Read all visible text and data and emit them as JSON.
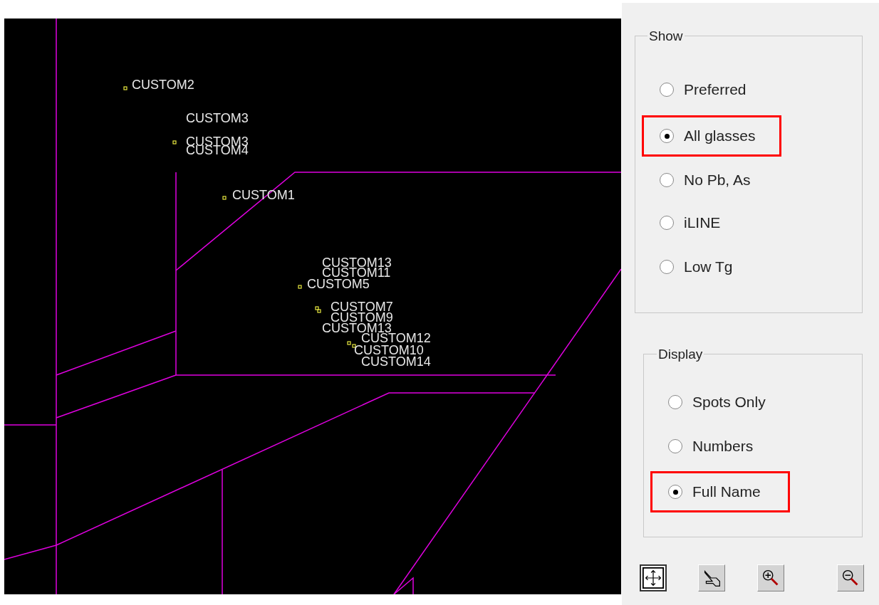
{
  "plot": {
    "points": [
      {
        "label": "CUSTOM2",
        "marker": true
      },
      {
        "label": "CUSTOM3",
        "marker": false
      },
      {
        "label": "CUSTOM3",
        "marker": true
      },
      {
        "label": "CUSTOM4",
        "marker": false
      },
      {
        "label": "CUSTOM1",
        "marker": true
      },
      {
        "label": "CUSTOM13",
        "marker": false
      },
      {
        "label": "CUSTOM11",
        "marker": false
      },
      {
        "label": "CUSTOM5",
        "marker": true
      },
      {
        "label": "CUSTOM7",
        "marker": true
      },
      {
        "label": "CUSTOM9",
        "marker": true
      },
      {
        "label": "CUSTOM13",
        "marker": false
      },
      {
        "label": "CUSTOM12",
        "marker": true
      },
      {
        "label": "CUSTOM10",
        "marker": true
      },
      {
        "label": "CUSTOM14",
        "marker": false
      }
    ]
  },
  "show_group": {
    "title": "Show",
    "options": [
      {
        "label": "Preferred",
        "selected": false,
        "highlighted": false
      },
      {
        "label": "All glasses",
        "selected": true,
        "highlighted": true
      },
      {
        "label": "No Pb, As",
        "selected": false,
        "highlighted": false
      },
      {
        "label": "iLINE",
        "selected": false,
        "highlighted": false
      },
      {
        "label": "Low Tg",
        "selected": false,
        "highlighted": false
      }
    ]
  },
  "display_group": {
    "title": "Display",
    "options": [
      {
        "label": "Spots Only",
        "selected": false,
        "highlighted": false
      },
      {
        "label": "Numbers",
        "selected": false,
        "highlighted": false
      },
      {
        "label": "Full Name",
        "selected": true,
        "highlighted": true
      }
    ]
  },
  "tools": [
    {
      "kind": "fit",
      "selected": true
    },
    {
      "kind": "pan",
      "selected": false
    },
    {
      "kind": "zoom_in",
      "selected": false
    },
    {
      "kind": "zoom_out",
      "selected": false
    }
  ]
}
